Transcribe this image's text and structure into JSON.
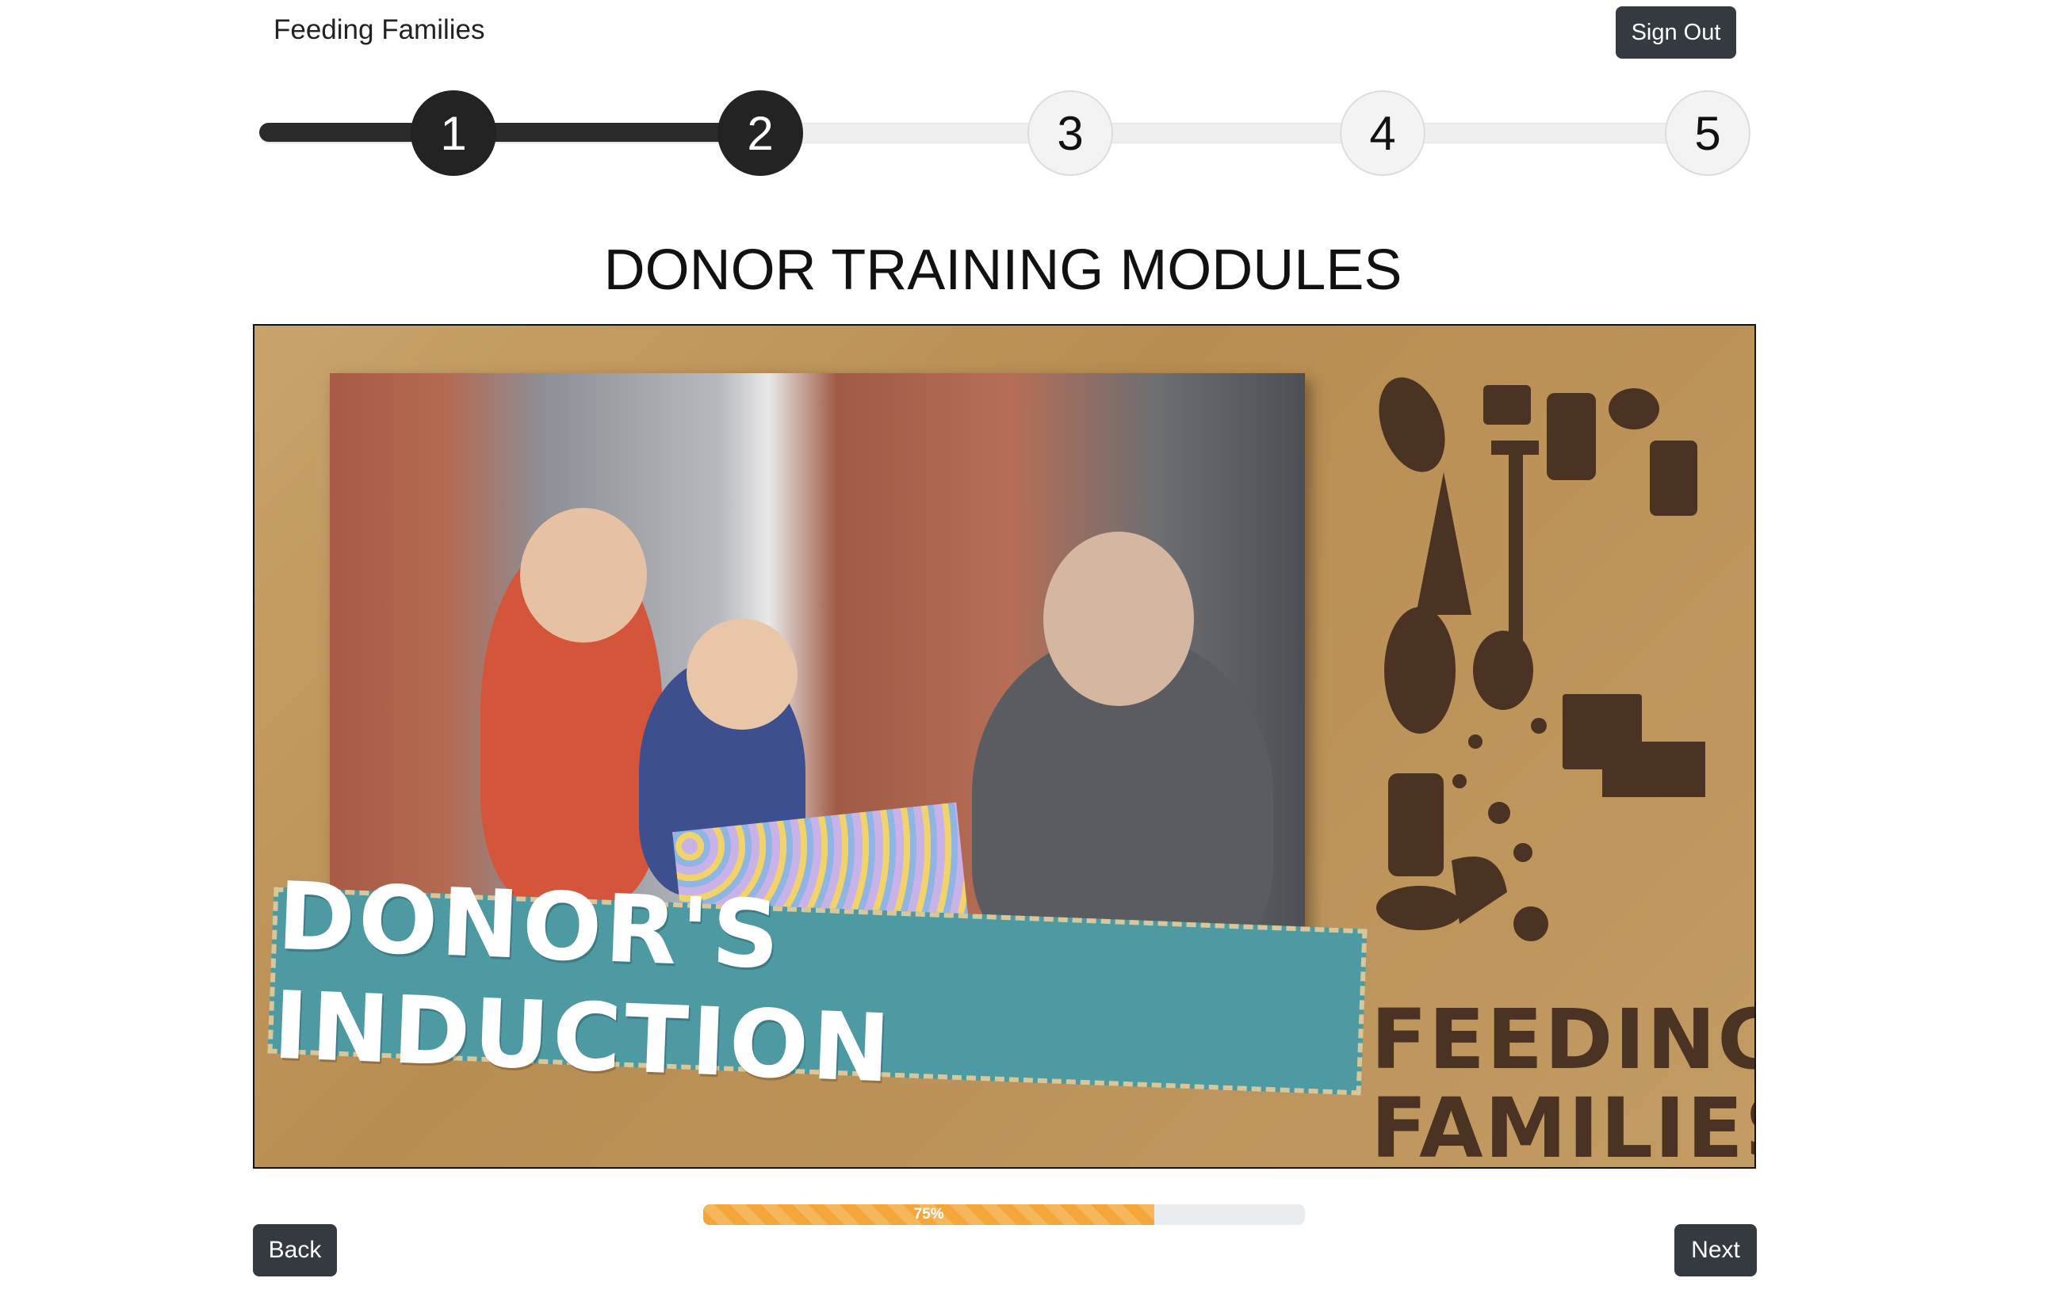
{
  "header": {
    "brand": "Feeding Families",
    "sign_out_label": "Sign Out"
  },
  "stepper": {
    "steps": [
      {
        "label": "1",
        "state": "complete"
      },
      {
        "label": "2",
        "state": "complete"
      },
      {
        "label": "3",
        "state": "incomplete"
      },
      {
        "label": "4",
        "state": "incomplete"
      },
      {
        "label": "5",
        "state": "incomplete"
      }
    ],
    "current_step": 2,
    "colors": {
      "complete": "#232323",
      "incomplete": "#f3f3f3"
    }
  },
  "page": {
    "title": "DONOR TRAINING MODULES"
  },
  "video": {
    "banner_text": "DONOR'S INDUCTION",
    "brand_line1": "FEEDING",
    "brand_line2": "FAMILIES",
    "colors": {
      "banner": "#4e9aa3",
      "brand_text": "#4a3322"
    }
  },
  "progress": {
    "value": 75,
    "label": "75%",
    "color": "#f4a63a"
  },
  "nav": {
    "back_label": "Back",
    "next_label": "Next"
  }
}
